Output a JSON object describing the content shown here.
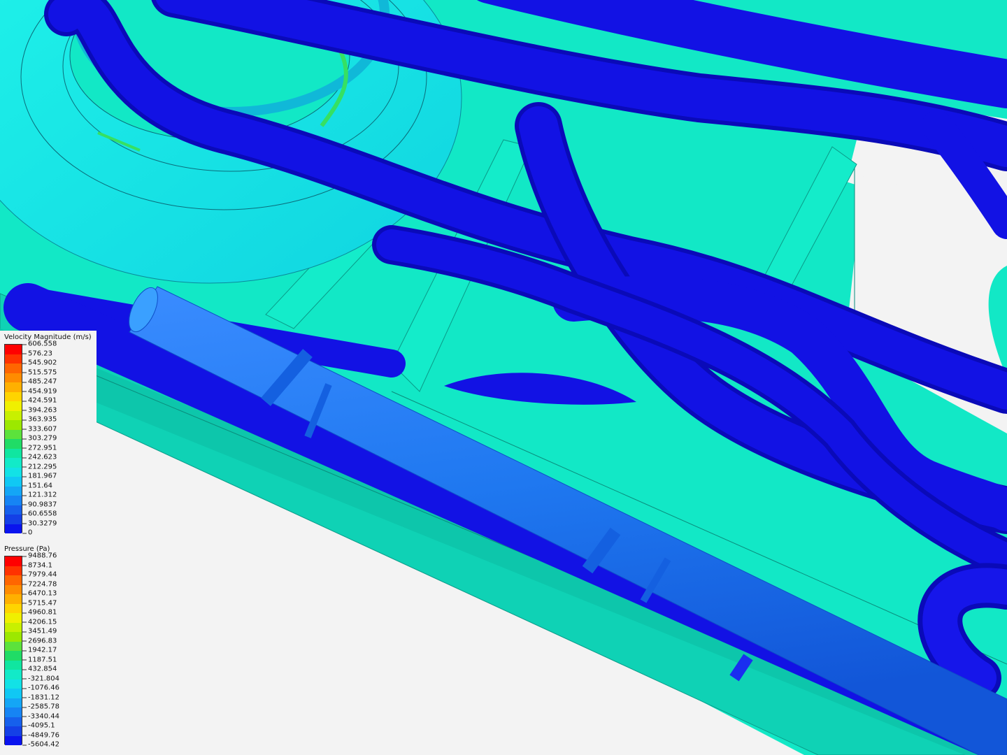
{
  "scene": {
    "background": "#f3f3f3",
    "colors": {
      "surface": "#12e8c6",
      "surface_dark": "#0fcfb4",
      "pipe": "#1010e8",
      "pipe_dark": "#0a0ab8",
      "pipe_light": "#2a4cff",
      "rod": "#1f7bf0",
      "torus": "#18f0e6",
      "torus_edge": "#0ec6d6",
      "hot_spot": "#36e062"
    }
  },
  "legends": {
    "velocity": {
      "title": "Velocity Magnitude (m/s)",
      "ticks": [
        "606.558",
        "576.23",
        "545.902",
        "515.575",
        "485.247",
        "454.919",
        "424.591",
        "394.263",
        "363.935",
        "333.607",
        "303.279",
        "272.951",
        "242.623",
        "212.295",
        "181.967",
        "151.64",
        "121.312",
        "90.9837",
        "60.6558",
        "30.3279",
        "0"
      ]
    },
    "pressure": {
      "title": "Pressure (Pa)",
      "ticks": [
        "9488.76",
        "8734.1",
        "7979.44",
        "7224.78",
        "6470.13",
        "5715.47",
        "4960.81",
        "4206.15",
        "3451.49",
        "2696.83",
        "1942.17",
        "1187.51",
        "432.854",
        "-321.804",
        "-1076.46",
        "-1831.12",
        "-2585.78",
        "-3340.44",
        "-4095.1",
        "-4849.76",
        "-5604.42"
      ]
    },
    "palette": [
      "#ff0000",
      "#ff3200",
      "#ff6600",
      "#ff8c00",
      "#ffb000",
      "#ffd400",
      "#f0f000",
      "#c8f000",
      "#9ce800",
      "#5ce23c",
      "#20dc66",
      "#10e6a0",
      "#12eac8",
      "#12e2e6",
      "#10c8f4",
      "#14a6f6",
      "#1684f4",
      "#1660ec",
      "#1440e6",
      "#0a14ee"
    ]
  }
}
